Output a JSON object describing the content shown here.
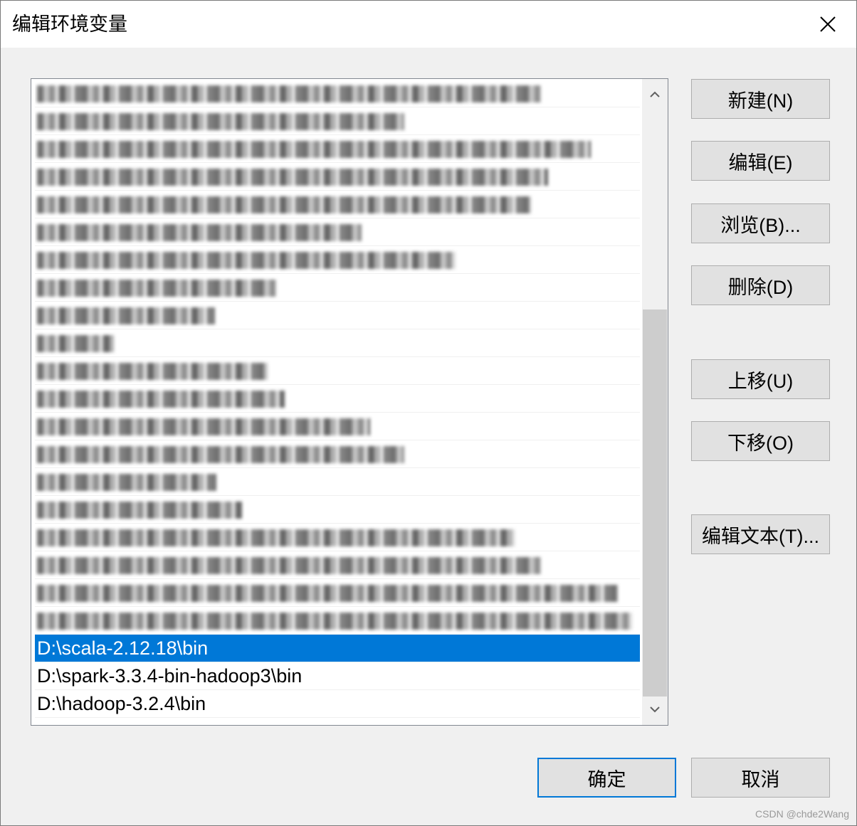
{
  "dialog": {
    "title": "编辑环境变量",
    "close_icon": "close-icon"
  },
  "list": {
    "hidden_rows": 20,
    "items": [
      {
        "label": "D:\\scala-2.12.18\\bin",
        "selected": true
      },
      {
        "label": "D:\\spark-3.3.4-bin-hadoop3\\bin",
        "selected": false
      },
      {
        "label": "D:\\hadoop-3.2.4\\bin",
        "selected": false
      }
    ]
  },
  "buttons": {
    "new": "新建(N)",
    "edit": "编辑(E)",
    "browse": "浏览(B)...",
    "delete": "删除(D)",
    "move_up": "上移(U)",
    "move_down": "下移(O)",
    "edit_text": "编辑文本(T)...",
    "ok": "确定",
    "cancel": "取消"
  },
  "scrollbar": {
    "up_icon": "chevron-up-icon",
    "down_icon": "chevron-down-icon"
  },
  "watermark": "CSDN @chde2Wang",
  "colors": {
    "selection": "#0078d7",
    "default_button_border": "#0078d7"
  }
}
